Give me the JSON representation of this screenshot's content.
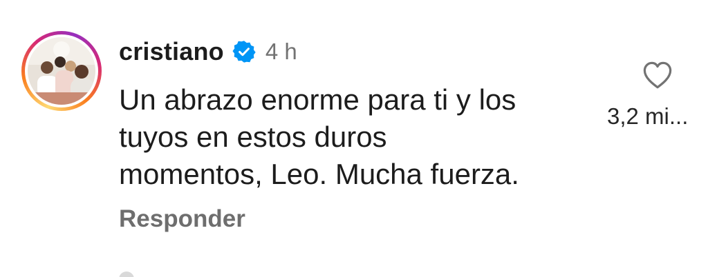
{
  "comment": {
    "username": "cristiano",
    "verified": true,
    "time_ago": "4 h",
    "text_lines": [
      "Un abrazo enorme para ti y los",
      "tuyos en estos duros",
      "momentos, Leo. Mucha fuerza."
    ],
    "reply_label": "Responder",
    "like_count": "3,2 mi..."
  },
  "icons": {
    "verified": "verified-badge-icon",
    "like": "heart-outline-icon"
  },
  "colors": {
    "verified_blue": "#0095f6",
    "text": "#1c1c1c",
    "muted": "#737373"
  }
}
